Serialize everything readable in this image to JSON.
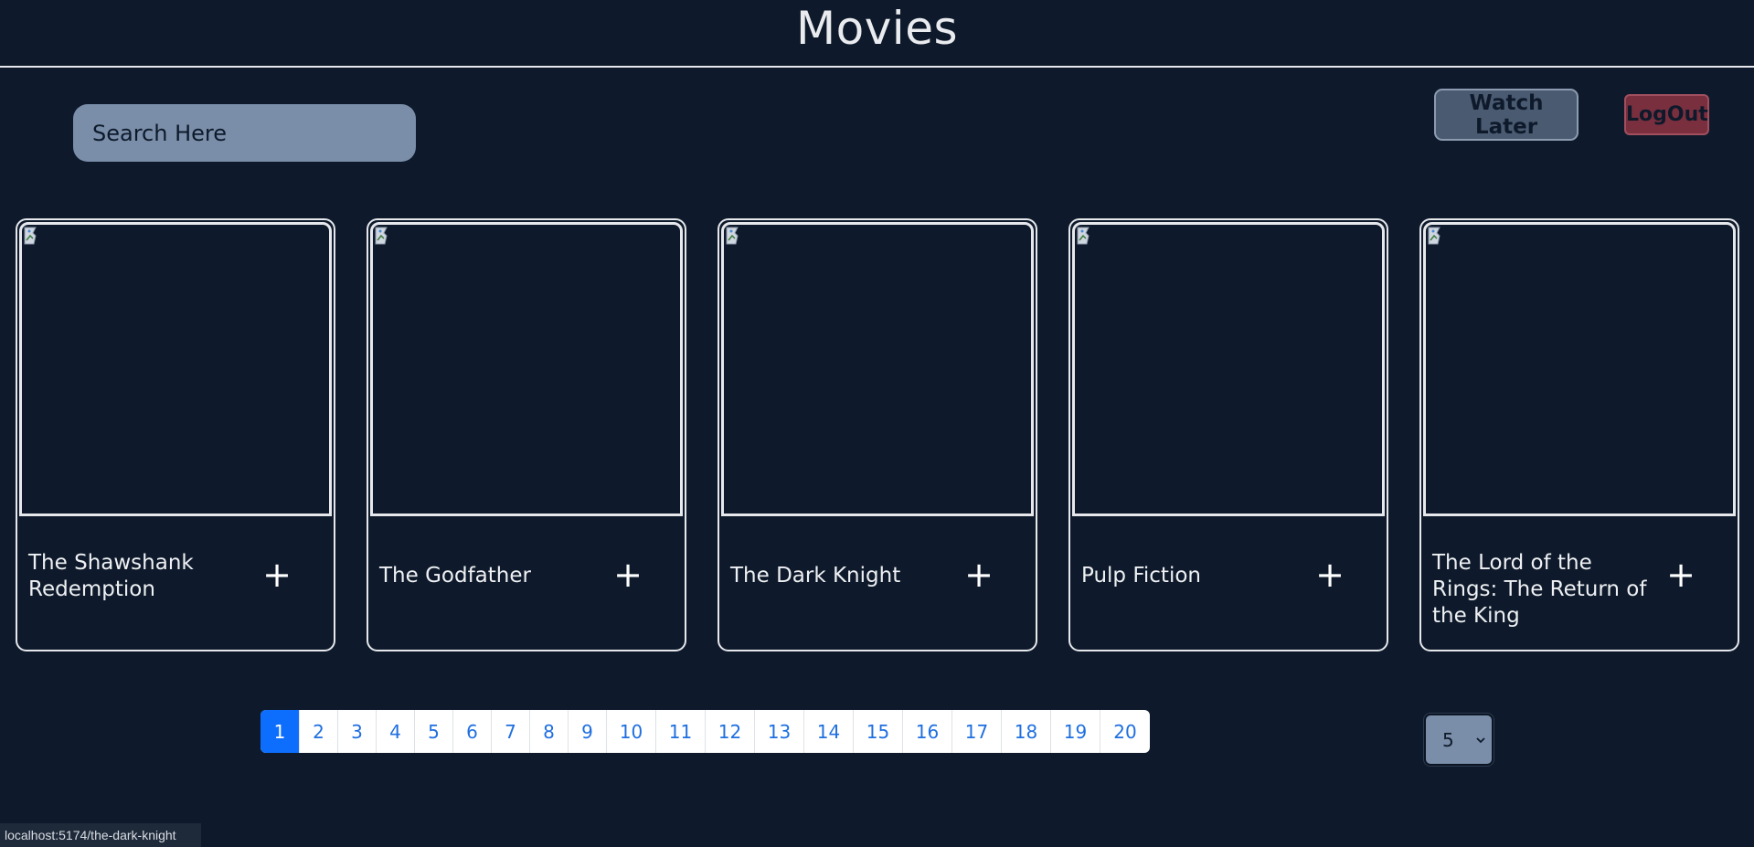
{
  "header": {
    "title": "Movies"
  },
  "search": {
    "placeholder": "Search Here"
  },
  "actions": {
    "watch_later": "Watch Later",
    "logout": "LogOut"
  },
  "cards": [
    {
      "title": "The Shawshank Redemption",
      "add_label": "+"
    },
    {
      "title": "The Godfather",
      "add_label": "+"
    },
    {
      "title": "The Dark Knight",
      "add_label": "+"
    },
    {
      "title": "Pulp Fiction",
      "add_label": "+"
    },
    {
      "title": "The Lord of the Rings: The Return of the King",
      "add_label": "+"
    }
  ],
  "pagination": {
    "pages": [
      "1",
      "2",
      "3",
      "4",
      "5",
      "6",
      "7",
      "8",
      "9",
      "10",
      "11",
      "12",
      "13",
      "14",
      "15",
      "16",
      "17",
      "18",
      "19",
      "20"
    ],
    "active": "1"
  },
  "page_size": {
    "selected": "5"
  },
  "status_bar": {
    "url": "localhost:5174/the-dark-knight"
  },
  "colors": {
    "background": "#0e1a2b",
    "search_bg": "#7a8ea9",
    "watch_later_bg": "#4a5a70",
    "logout_bg": "#7a2f3e",
    "pagination_active": "#0d6efd",
    "pagination_link": "#1f6fe0"
  },
  "icons": {
    "add": "plus-icon",
    "poster": "broken-image-icon",
    "select": "chevron-down-icon"
  }
}
